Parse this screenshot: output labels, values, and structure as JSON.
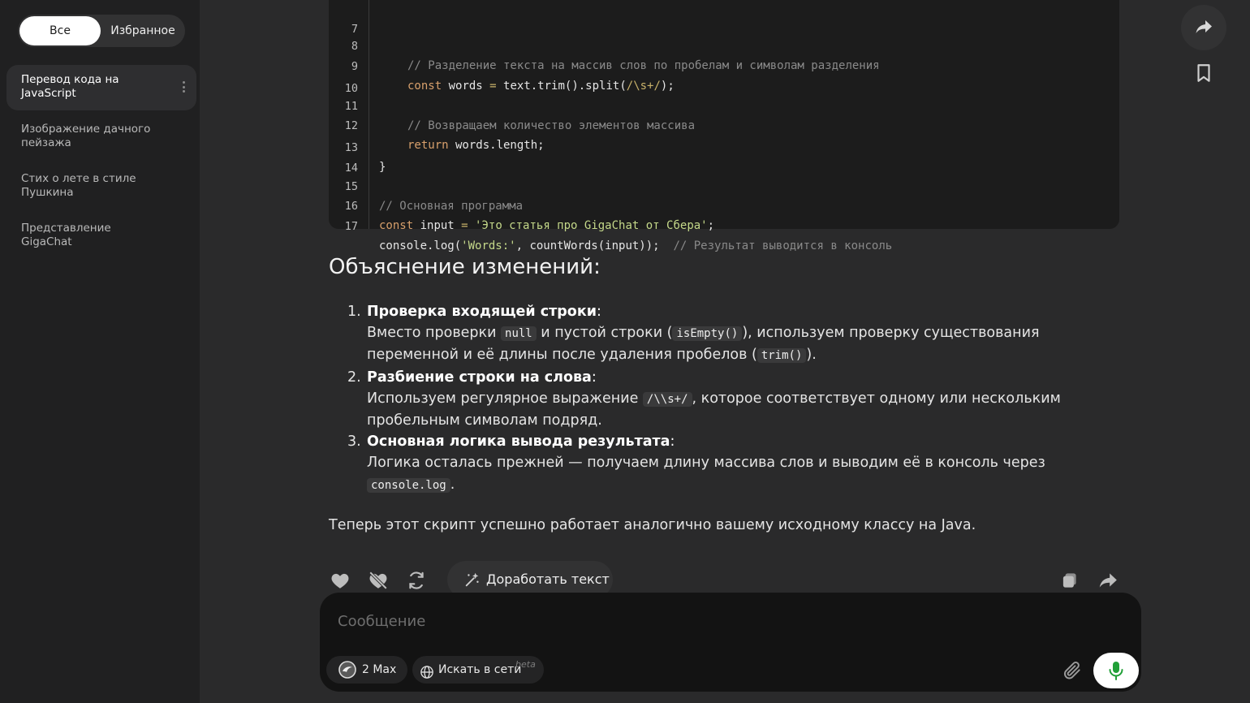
{
  "sidebar": {
    "segments": {
      "all": "Все",
      "favorites": "Избранное"
    },
    "chats": [
      {
        "title_line1": "Перевод кода на",
        "title_line2": "JavaScript"
      },
      {
        "title_line1": "Изображение дачного",
        "title_line2": "пейзажа"
      },
      {
        "title_line1": "Стих о лете в стиле",
        "title_line2": "Пушкина"
      },
      {
        "title_line1": "Представление",
        "title_line2": "GigaChat"
      }
    ]
  },
  "code": {
    "line_numbers": [
      "7",
      "8",
      "9",
      "10",
      "11",
      "12",
      "13",
      "14",
      "15",
      "16",
      "17"
    ],
    "l8_comment": "// Разделение текста на массив слов по пробелам и символам разделения",
    "l9_kw": "const",
    "l9_a": " words ",
    "l9_op": "=",
    "l9_b": " text.trim().split(",
    "l9_re": "/\\s+/",
    "l9_c": ");",
    "l11_comment": "// Возвращаем количество элементов массива",
    "l12_kw": "return",
    "l12_a": " words.length;",
    "l13": "}",
    "l15_comment": "// Основная программа",
    "l16_kw": "const",
    "l16_a": " input ",
    "l16_op": "=",
    "l16_str": " 'Это статья про GigaChat от Сбера'",
    "l16_end": ";",
    "l17_a": "console.log(",
    "l17_str": "'Words:'",
    "l17_b": ", countWords(input));  ",
    "l17_comment": "// Результат выводится в консоль"
  },
  "content": {
    "heading": "Объяснение изменений:",
    "items": [
      {
        "num": "1.",
        "title": "Проверка входящей строки",
        "colon": ":",
        "l1_a": "Вместо проверки ",
        "l1_code1": "null",
        "l1_b": " и пустой строки (",
        "l1_code2": "isEmpty()",
        "l1_c": "), используем проверку существования",
        "l2_a": "переменной и её длины после удаления пробелов (",
        "l2_code": "trim()",
        "l2_b": ")."
      },
      {
        "num": "2.",
        "title": "Разбиение строки на слова",
        "colon": ":",
        "l1_a": "Используем регулярное выражение ",
        "l1_code": "/\\\\s+/",
        "l1_b": ", которое соответствует одному или нескольким",
        "l2": "пробельным символам подряд."
      },
      {
        "num": "3.",
        "title": "Основная логика вывода результата",
        "colon": ":",
        "l1": "Логика осталась прежней — получаем длину массива слов и выводим её в консоль через",
        "l2_code": "console.log",
        "l2_b": "."
      }
    ],
    "final": "Теперь этот скрипт успешно работает аналогично вашему исходному классу на Java."
  },
  "actions": {
    "refine_label": "Доработать текст"
  },
  "composer": {
    "placeholder": "Сообщение",
    "model_label": "2 Max",
    "web_search_label": "Искать в сети",
    "beta_label": "beta"
  },
  "colors": {
    "accent_mic": "#21a038",
    "background": "#2a2a2b",
    "sidebar": "#202021",
    "code_bg": "#1c1c1c"
  }
}
